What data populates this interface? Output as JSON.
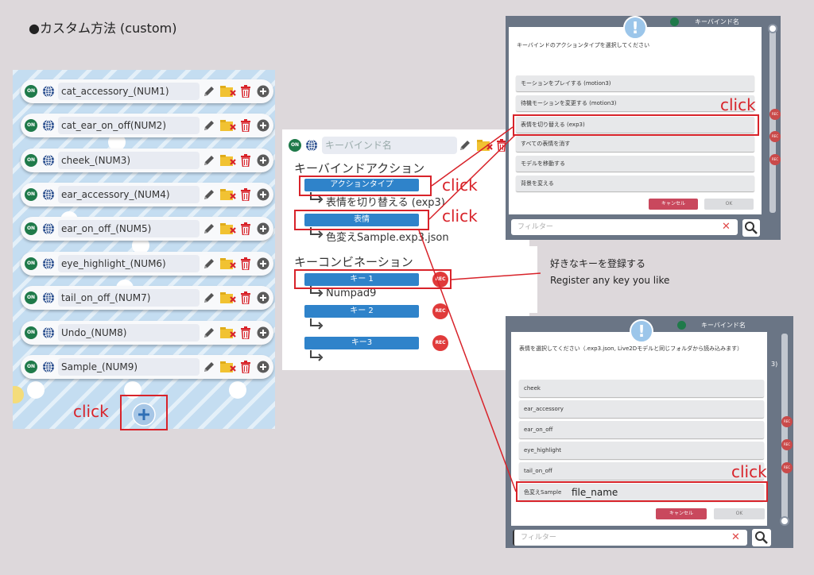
{
  "heading": "●カスタム方法 (custom)",
  "click_label": "click",
  "rows": [
    {
      "name": "cat_accessory_(NUM1)",
      "status": "ON"
    },
    {
      "name": "cat_ear_on_off(NUM2)",
      "status": "ON"
    },
    {
      "name": "cheek_(NUM3)",
      "status": "ON"
    },
    {
      "name": "ear_accessory_(NUM4)",
      "status": "ON"
    },
    {
      "name": "ear_on_off_(NUM5)",
      "status": "ON"
    },
    {
      "name": "eye_highlight_(NUM6)",
      "status": "ON"
    },
    {
      "name": "tail_on_off_(NUM7)",
      "status": "ON"
    },
    {
      "name": "Undo_(NUM8)",
      "status": "ON"
    },
    {
      "name": "Sample_(NUM9)",
      "status": "ON"
    }
  ],
  "keybind_editor": {
    "status": "ON",
    "name_placeholder": "キーバインド名",
    "action_section": "キーバインドアクション",
    "action_type_button": "アクションタイプ",
    "action_type_value": "表情を切り替える (exp3)",
    "expression_button": "表情",
    "expression_value": "色変えSample.exp3.json",
    "combo_section": "キーコンビネーション",
    "keys": [
      {
        "label": "キー 1",
        "value": "Numpad9"
      },
      {
        "label": "キー 2",
        "value": ""
      },
      {
        "label": "キー3",
        "value": ""
      }
    ],
    "rec_label": "REC"
  },
  "annotation": {
    "jp": "好きなキーを登録する",
    "en": "Register any key you like"
  },
  "action_dialog": {
    "header_text": "キーバインド名",
    "title": "キーバインドのアクションタイプを選択してください",
    "options": [
      "モーションをプレイする (motion3)",
      "待機モーションを変更する (motion3)",
      "表情を切り替える (exp3)",
      "すべての表情を消す",
      "モデルを移動する",
      "背景を変える"
    ],
    "cancel": "キャンセル",
    "ok": "OK",
    "filter_placeholder": "フィルター"
  },
  "expression_dialog": {
    "header_text": "キーバインド名",
    "side_text": "3)",
    "title": "表情を選択してください（.exp3.json, Live2Dモデルと同じフォルダから読み込みます）",
    "options": [
      "cheek",
      "ear_accessory",
      "ear_on_off",
      "eye_highlight",
      "tail_on_off"
    ],
    "custom_option_label": "色変えSample",
    "custom_option_file": "file_name",
    "cancel": "キャンセル",
    "ok": "OK",
    "filter_placeholder": "フィルター"
  },
  "colors": {
    "accent_red": "#d8232a",
    "button_blue": "#2f83ca",
    "on_green": "#1f7a4a",
    "panel_blue": "#c4ddf1"
  }
}
